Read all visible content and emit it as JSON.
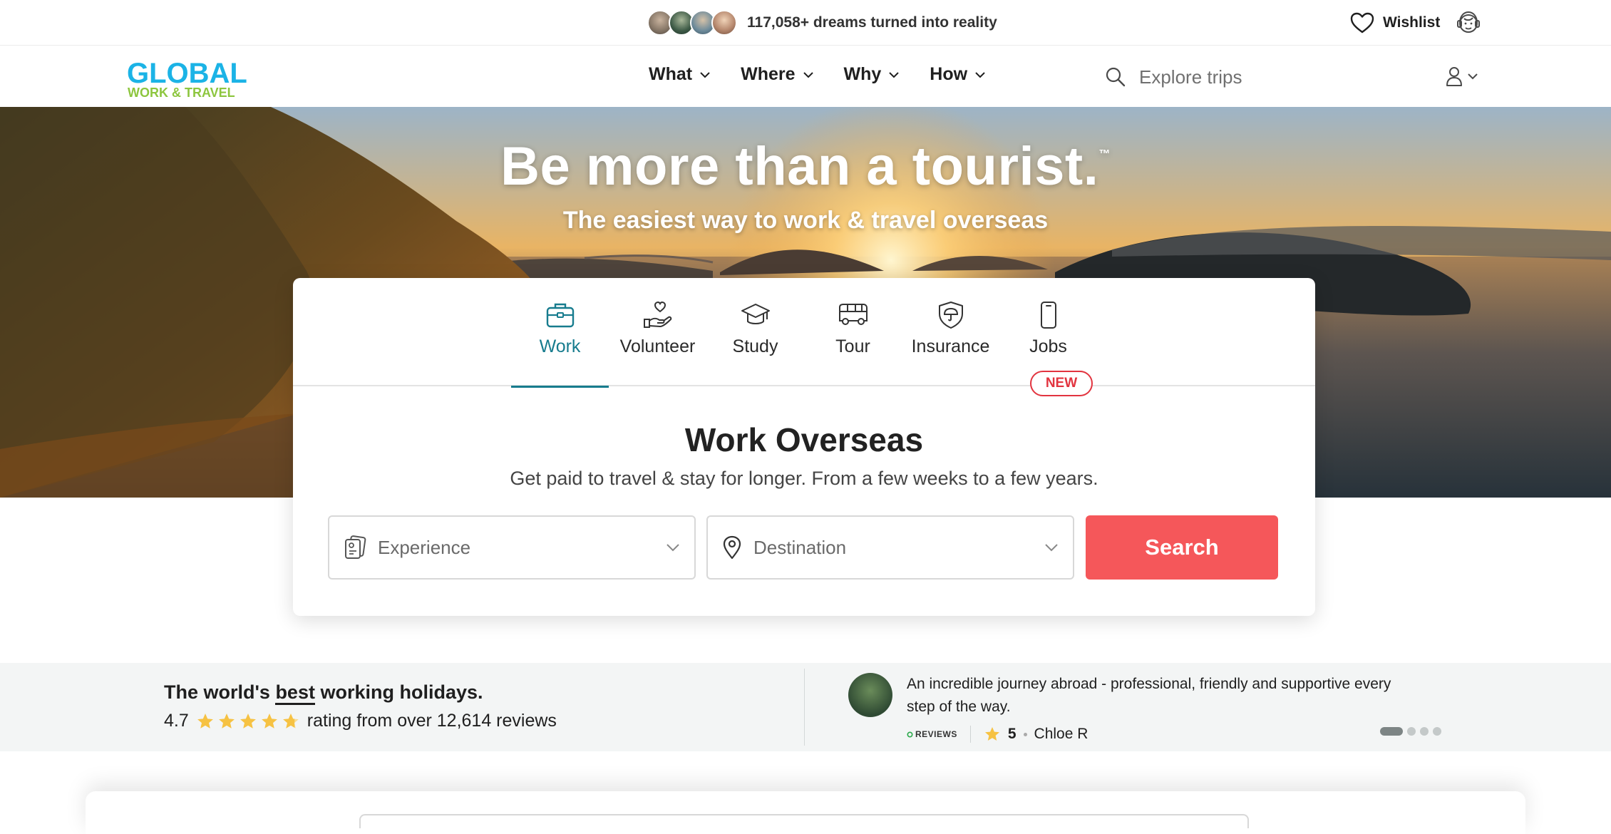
{
  "topbar": {
    "dreams_text": "117,058+ dreams turned into reality",
    "avatar_colors": [
      "#8a7a6a",
      "#3d5a46",
      "#6c8a9a",
      "#b88a70"
    ],
    "wishlist_label": "Wishlist"
  },
  "nav": {
    "logo_line1": "GLOBAL",
    "logo_line2": "WORK & TRAVEL",
    "logo_colors": {
      "primary": "#1bb3e6",
      "secondary": "#8dc63f"
    },
    "menu": [
      {
        "label": "What"
      },
      {
        "label": "Where"
      },
      {
        "label": "Why"
      },
      {
        "label": "How"
      }
    ],
    "search_placeholder": "Explore trips"
  },
  "hero": {
    "title": "Be more than a tourist.",
    "trademark": "™",
    "subtitle": "The easiest way to work & travel overseas"
  },
  "search_card": {
    "tabs": [
      {
        "label": "Work",
        "icon": "briefcase-icon",
        "active": true
      },
      {
        "label": "Volunteer",
        "icon": "hand-heart-icon",
        "active": false
      },
      {
        "label": "Study",
        "icon": "graduation-cap-icon",
        "active": false
      },
      {
        "label": "Tour",
        "icon": "bus-icon",
        "active": false
      },
      {
        "label": "Insurance",
        "icon": "shield-umbrella-icon",
        "active": false
      },
      {
        "label": "Jobs",
        "icon": "phone-icon",
        "active": false
      }
    ],
    "new_badge": "NEW",
    "title": "Work Overseas",
    "subtitle": "Get paid to travel & stay for longer. From a few weeks to a few years.",
    "experience_placeholder": "Experience",
    "destination_placeholder": "Destination",
    "search_label": "Search",
    "accent_color": "#177c8e",
    "button_color": "#f5575a"
  },
  "reviews": {
    "headline_pre": "The world's ",
    "headline_emph": "best",
    "headline_post": " working holidays.",
    "rating": "4.7",
    "rating_stars": 4.7,
    "rating_text": "rating from over 12,614 reviews",
    "testimonial": {
      "quote": "An incredible journey abroad - professional, friendly and supportive every step of the way.",
      "source": "REVIEWS",
      "score": "5",
      "name": "Chloe R"
    },
    "carousel_total": 4,
    "carousel_active": 1
  }
}
